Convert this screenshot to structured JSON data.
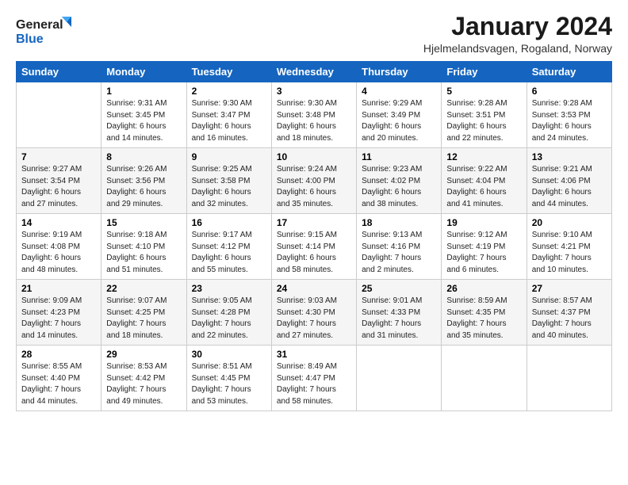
{
  "logo": {
    "general": "General",
    "blue": "Blue"
  },
  "title": "January 2024",
  "location": "Hjelmelandsvagen, Rogaland, Norway",
  "days_header": [
    "Sunday",
    "Monday",
    "Tuesday",
    "Wednesday",
    "Thursday",
    "Friday",
    "Saturday"
  ],
  "weeks": [
    [
      {
        "day": "",
        "info": ""
      },
      {
        "day": "1",
        "info": "Sunrise: 9:31 AM\nSunset: 3:45 PM\nDaylight: 6 hours\nand 14 minutes."
      },
      {
        "day": "2",
        "info": "Sunrise: 9:30 AM\nSunset: 3:47 PM\nDaylight: 6 hours\nand 16 minutes."
      },
      {
        "day": "3",
        "info": "Sunrise: 9:30 AM\nSunset: 3:48 PM\nDaylight: 6 hours\nand 18 minutes."
      },
      {
        "day": "4",
        "info": "Sunrise: 9:29 AM\nSunset: 3:49 PM\nDaylight: 6 hours\nand 20 minutes."
      },
      {
        "day": "5",
        "info": "Sunrise: 9:28 AM\nSunset: 3:51 PM\nDaylight: 6 hours\nand 22 minutes."
      },
      {
        "day": "6",
        "info": "Sunrise: 9:28 AM\nSunset: 3:53 PM\nDaylight: 6 hours\nand 24 minutes."
      }
    ],
    [
      {
        "day": "7",
        "info": "Sunrise: 9:27 AM\nSunset: 3:54 PM\nDaylight: 6 hours\nand 27 minutes."
      },
      {
        "day": "8",
        "info": "Sunrise: 9:26 AM\nSunset: 3:56 PM\nDaylight: 6 hours\nand 29 minutes."
      },
      {
        "day": "9",
        "info": "Sunrise: 9:25 AM\nSunset: 3:58 PM\nDaylight: 6 hours\nand 32 minutes."
      },
      {
        "day": "10",
        "info": "Sunrise: 9:24 AM\nSunset: 4:00 PM\nDaylight: 6 hours\nand 35 minutes."
      },
      {
        "day": "11",
        "info": "Sunrise: 9:23 AM\nSunset: 4:02 PM\nDaylight: 6 hours\nand 38 minutes."
      },
      {
        "day": "12",
        "info": "Sunrise: 9:22 AM\nSunset: 4:04 PM\nDaylight: 6 hours\nand 41 minutes."
      },
      {
        "day": "13",
        "info": "Sunrise: 9:21 AM\nSunset: 4:06 PM\nDaylight: 6 hours\nand 44 minutes."
      }
    ],
    [
      {
        "day": "14",
        "info": "Sunrise: 9:19 AM\nSunset: 4:08 PM\nDaylight: 6 hours\nand 48 minutes."
      },
      {
        "day": "15",
        "info": "Sunrise: 9:18 AM\nSunset: 4:10 PM\nDaylight: 6 hours\nand 51 minutes."
      },
      {
        "day": "16",
        "info": "Sunrise: 9:17 AM\nSunset: 4:12 PM\nDaylight: 6 hours\nand 55 minutes."
      },
      {
        "day": "17",
        "info": "Sunrise: 9:15 AM\nSunset: 4:14 PM\nDaylight: 6 hours\nand 58 minutes."
      },
      {
        "day": "18",
        "info": "Sunrise: 9:13 AM\nSunset: 4:16 PM\nDaylight: 7 hours\nand 2 minutes."
      },
      {
        "day": "19",
        "info": "Sunrise: 9:12 AM\nSunset: 4:19 PM\nDaylight: 7 hours\nand 6 minutes."
      },
      {
        "day": "20",
        "info": "Sunrise: 9:10 AM\nSunset: 4:21 PM\nDaylight: 7 hours\nand 10 minutes."
      }
    ],
    [
      {
        "day": "21",
        "info": "Sunrise: 9:09 AM\nSunset: 4:23 PM\nDaylight: 7 hours\nand 14 minutes."
      },
      {
        "day": "22",
        "info": "Sunrise: 9:07 AM\nSunset: 4:25 PM\nDaylight: 7 hours\nand 18 minutes."
      },
      {
        "day": "23",
        "info": "Sunrise: 9:05 AM\nSunset: 4:28 PM\nDaylight: 7 hours\nand 22 minutes."
      },
      {
        "day": "24",
        "info": "Sunrise: 9:03 AM\nSunset: 4:30 PM\nDaylight: 7 hours\nand 27 minutes."
      },
      {
        "day": "25",
        "info": "Sunrise: 9:01 AM\nSunset: 4:33 PM\nDaylight: 7 hours\nand 31 minutes."
      },
      {
        "day": "26",
        "info": "Sunrise: 8:59 AM\nSunset: 4:35 PM\nDaylight: 7 hours\nand 35 minutes."
      },
      {
        "day": "27",
        "info": "Sunrise: 8:57 AM\nSunset: 4:37 PM\nDaylight: 7 hours\nand 40 minutes."
      }
    ],
    [
      {
        "day": "28",
        "info": "Sunrise: 8:55 AM\nSunset: 4:40 PM\nDaylight: 7 hours\nand 44 minutes."
      },
      {
        "day": "29",
        "info": "Sunrise: 8:53 AM\nSunset: 4:42 PM\nDaylight: 7 hours\nand 49 minutes."
      },
      {
        "day": "30",
        "info": "Sunrise: 8:51 AM\nSunset: 4:45 PM\nDaylight: 7 hours\nand 53 minutes."
      },
      {
        "day": "31",
        "info": "Sunrise: 8:49 AM\nSunset: 4:47 PM\nDaylight: 7 hours\nand 58 minutes."
      },
      {
        "day": "",
        "info": ""
      },
      {
        "day": "",
        "info": ""
      },
      {
        "day": "",
        "info": ""
      }
    ]
  ]
}
